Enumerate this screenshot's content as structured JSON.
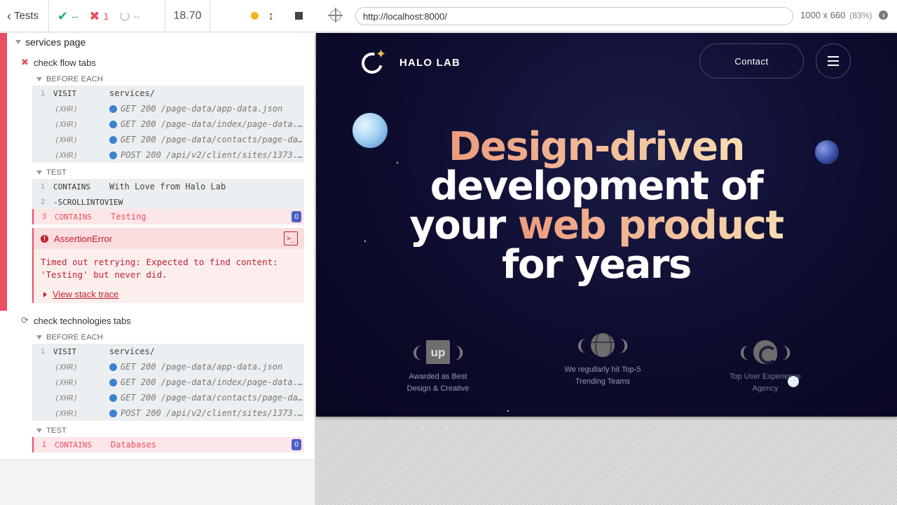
{
  "stats": {
    "tests_label": "Tests",
    "passed": "--",
    "failed": "1",
    "pending": "--",
    "duration": "18.70"
  },
  "suite": {
    "title": "services page",
    "tests": [
      {
        "title": "check flow tabs",
        "state": "failed",
        "before_each": {
          "label": "BEFORE EACH",
          "commands": [
            {
              "num": "1",
              "name": "VISIT",
              "message": "services/"
            },
            {
              "num": "",
              "name": "(XHR)",
              "message": "GET 200 /page-data/app-data.json"
            },
            {
              "num": "",
              "name": "(XHR)",
              "message": "GET 200 /page-data/index/page-data.json"
            },
            {
              "num": "",
              "name": "(XHR)",
              "message": "GET 200 /page-data/contacts/page-data.json"
            },
            {
              "num": "",
              "name": "(XHR)",
              "message": "POST 200 /api/v2/client/sites/1373..."
            }
          ]
        },
        "test_body": {
          "label": "TEST",
          "commands": [
            {
              "num": "1",
              "name": "CONTAINS",
              "message": "With Love from Halo Lab"
            },
            {
              "num": "2",
              "name": "-SCROLLINTOVIEW",
              "message": ""
            },
            {
              "num": "3",
              "name": "CONTAINS",
              "message": "Testing",
              "badge": "0"
            }
          ]
        },
        "error": {
          "name": "AssertionError",
          "message": "Timed out retrying: Expected to find content:\n'Testing' but never did.",
          "stack_link": "View stack trace"
        }
      },
      {
        "title": "check technologies tabs",
        "state": "running",
        "before_each": {
          "label": "BEFORE EACH",
          "commands": [
            {
              "num": "1",
              "name": "VISIT",
              "message": "services/"
            },
            {
              "num": "",
              "name": "(XHR)",
              "message": "GET 200 /page-data/app-data.json"
            },
            {
              "num": "",
              "name": "(XHR)",
              "message": "GET 200 /page-data/index/page-data.json"
            },
            {
              "num": "",
              "name": "(XHR)",
              "message": "GET 200 /page-data/contacts/page-data.json"
            },
            {
              "num": "",
              "name": "(XHR)",
              "message": "POST 200 /api/v2/client/sites/1373..."
            }
          ]
        },
        "test_body": {
          "label": "TEST",
          "commands": [
            {
              "num": "1",
              "name": "CONTAINS",
              "message": "Databases",
              "badge": "0"
            }
          ]
        }
      }
    ]
  },
  "aut": {
    "url": "http://localhost:8000/",
    "viewport": "1000 x 660",
    "scale": "(83%)",
    "info_glyph": "i"
  },
  "site": {
    "logo_text": "HALO LAB",
    "contact_label": "Contact",
    "hero": {
      "line1_grad": "Design-driven",
      "line2": "development of",
      "line3_pre": "your ",
      "line3_grad": "web product",
      "line4": "for years"
    },
    "awards": [
      {
        "text": "Awarded as Best Design & Creative",
        "emblem": "up"
      },
      {
        "text": "We regullarly hit Top-5 Trending Teams",
        "emblem": "dribbble"
      },
      {
        "text": "Top User Experience Agency",
        "emblem": "c"
      }
    ],
    "colors": {
      "background": "#0d0c2d",
      "accent_start": "#ec9b7e",
      "accent_end": "#f7dcb2"
    }
  },
  "icons": {
    "pass": "check-icon",
    "fail": "x-icon",
    "pending": "pending-icon",
    "warning": "warning-icon",
    "terminal": "terminal-icon"
  }
}
